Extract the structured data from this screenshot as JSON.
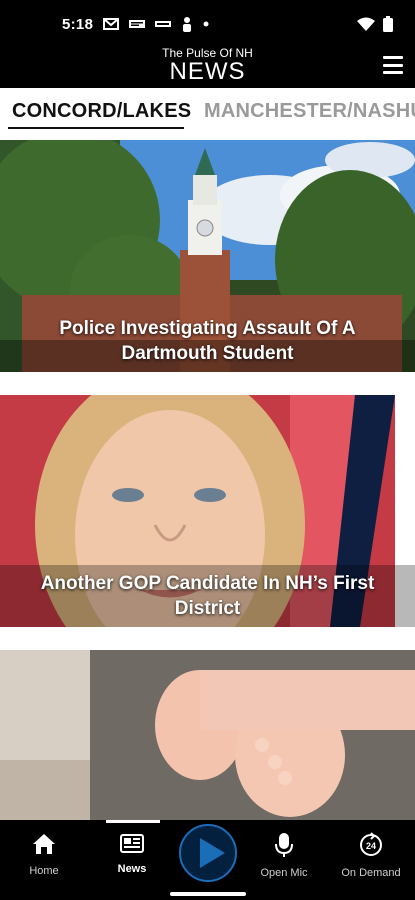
{
  "status_bar": {
    "time": "5:18",
    "icons": [
      "mail-icon",
      "news-app-icon",
      "nbc-icon",
      "person-icon",
      "dot-icon",
      "wifi-icon",
      "battery-icon"
    ]
  },
  "header": {
    "tagline": "The Pulse Of NH",
    "title": "NEWS"
  },
  "tabs": [
    {
      "label": "CONCORD/LAKES",
      "active": true
    },
    {
      "label": "MANCHESTER/NASHUA",
      "active": false
    }
  ],
  "stories": [
    {
      "title": "Police Investigating Assault Of A Dartmouth Student"
    },
    {
      "title": "Another GOP Candidate In NH’s First District"
    },
    {
      "title": ""
    }
  ],
  "bottom_nav": {
    "items": [
      {
        "label": "Home",
        "icon": "home-icon",
        "active": false
      },
      {
        "label": "News",
        "icon": "newspaper-icon",
        "active": true
      },
      {
        "label": "",
        "icon": "play-icon",
        "active": false
      },
      {
        "label": "Open Mic",
        "icon": "microphone-icon",
        "active": false
      },
      {
        "label": "On Demand",
        "icon": "on-demand-24-icon",
        "active": false
      }
    ]
  },
  "colors": {
    "accent": "#1a6db7",
    "play_fill": "#03203f",
    "tab_active": "#111111",
    "tab_inactive": "#9a9a9a"
  }
}
